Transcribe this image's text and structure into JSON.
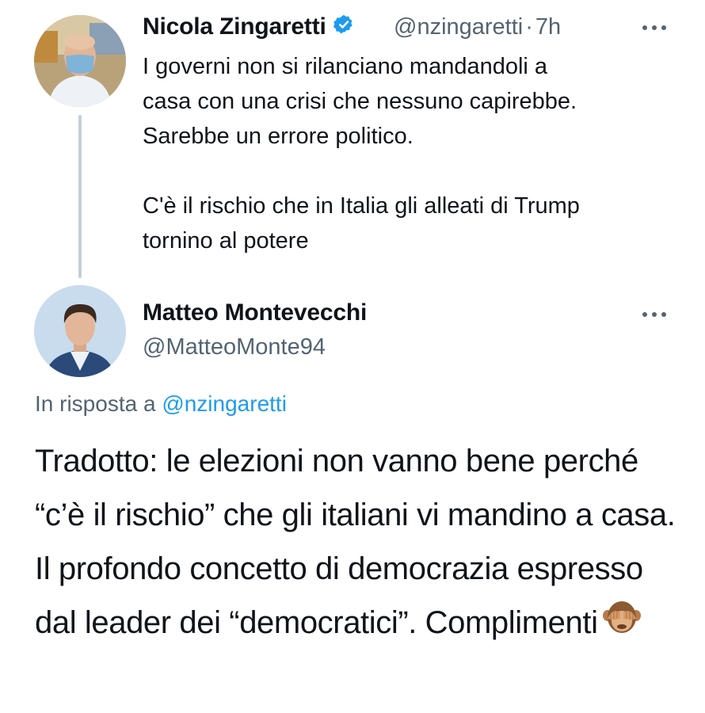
{
  "original_tweet": {
    "author_name": "Nicola Zingaretti",
    "verified": true,
    "handle": "@nzingaretti",
    "separator": "·",
    "time": "7h",
    "text": "I governi non si rilanciano mandandoli a\ncasa con una crisi che nessuno capirebbe.\nSarebbe un errore politico.\n\nC'è il rischio che in Italia gli alleati di Trump\ntornino al potere",
    "more_icon": "more-horizontal-icon"
  },
  "reply_tweet": {
    "author_name": "Matteo Montevecchi",
    "handle": "@MatteoMonte94",
    "more_icon": "more-horizontal-icon",
    "reply_prefix": "In risposta a",
    "reply_mention": "@nzingaretti",
    "text": "Tradotto: le elezioni non vanno bene perché “c’è il rischio” che gli italiani vi mandino a casa. Il profondo concetto di democrazia espresso dal leader dei “democratici”. Complimenti",
    "emoji": "see-no-evil-monkey"
  },
  "colors": {
    "text": "#0f1419",
    "secondary": "#536471",
    "link": "#1d9bf0",
    "thread_line": "#c4cfd6",
    "verified": "#1d9bf0"
  }
}
